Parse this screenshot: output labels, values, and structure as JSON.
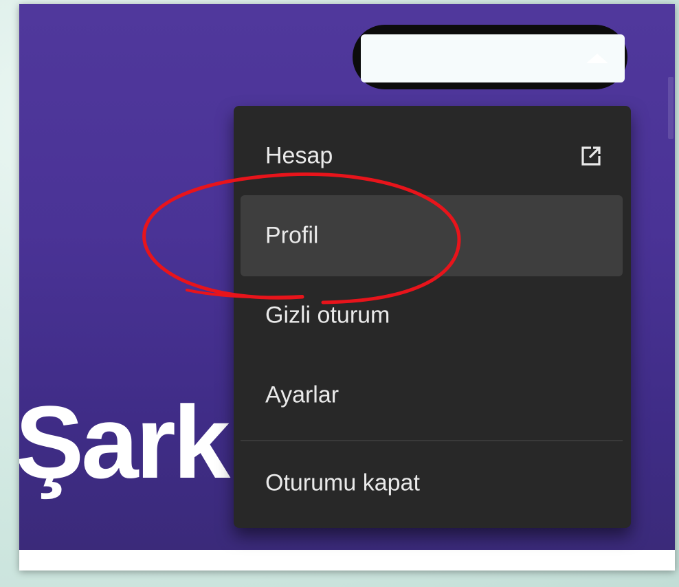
{
  "page": {
    "hero_title": "Şark"
  },
  "user_menu": {
    "items": [
      {
        "label": "Hesap",
        "icon": "external-link-icon"
      },
      {
        "label": "Profil",
        "state": "hover"
      },
      {
        "label": "Gizli oturum"
      },
      {
        "label": "Ayarlar"
      },
      {
        "label": "Oturumu kapat"
      }
    ]
  },
  "user_button": {
    "icon": "caret-up-icon"
  },
  "colors": {
    "background_top": "#50389c",
    "background_bottom": "#3a2a78",
    "menu_bg": "#282828",
    "menu_hover": "#3e3e3e",
    "annotation": "#e8141b"
  }
}
